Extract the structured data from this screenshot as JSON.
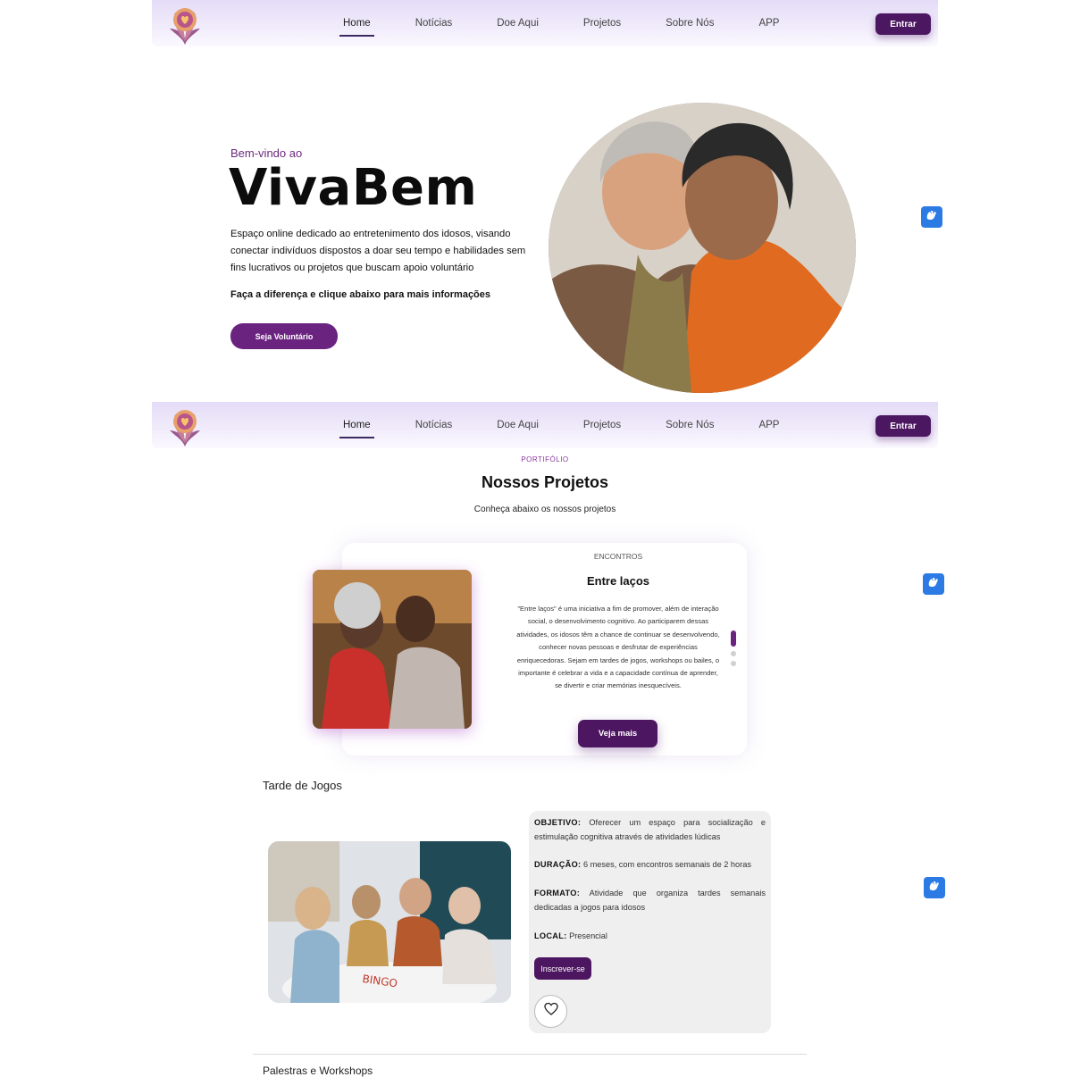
{
  "nav": {
    "links": [
      "Home",
      "Notícias",
      "Doe Aqui",
      "Projetos",
      "Sobre Nós",
      "APP"
    ],
    "enter_label": "Entrar"
  },
  "hero": {
    "welcome": "Bem-vindo ao",
    "title": "VivaBem",
    "description": "Espaço online dedicado ao entretenimento dos idosos, visando conectar indivíduos dispostos a doar seu tempo e habilidades sem fins lucrativos ou projetos que buscam apoio voluntário",
    "cta_text": "Faça a diferença e clique abaixo para mais informações",
    "button_label": "Seja Voluntário"
  },
  "projects": {
    "section_label": "PORTIFÓLIO",
    "title": "Nossos Projetos",
    "subtitle": "Conheça abaixo os nossos projetos",
    "card": {
      "category": "ENCONTROS",
      "title": "Entre laços",
      "description": "\"Entre laços\" é uma iniciativa a fim de promover, além de interação social, o desenvolvimento cognitivo. Ao participarem dessas atividades, os idosos têm a chance de continuar se desenvolvendo, conhecer novas pessoas e desfrutar de experiências enriquecedoras. Sejam em tardes de jogos, workshops ou bailes, o importante é celebrar a vida e a capacidade contínua de aprender, se divertir e criar memórias inesquecíveis.",
      "button_label": "Veja mais"
    },
    "project": {
      "name": "Tarde de Jogos",
      "objetivo_label": "OBJETIVO:",
      "objetivo": "Oferecer um espaço para socialização e estimulação cognitiva através de atividades lúdicas",
      "duracao_label": "DURAÇÃO:",
      "duracao": "6 meses, com encontros semanais de 2 horas",
      "formato_label": "FORMATO:",
      "formato": "Atividade que organiza tardes semanais dedicadas a jogos para idosos",
      "local_label": "LOCAL:",
      "local": "Presencial",
      "subscribe_label": "Inscrever-se",
      "photo_text": "BINGO"
    },
    "next_project_name": "Palestras e Workshops"
  },
  "icons": {
    "logo": "lotus-heart-logo",
    "accessibility": "sign-language-hands-icon",
    "favorite": "heart-icon"
  },
  "colors": {
    "brand_purple": "#4d1661",
    "accent_purple": "#6b2380",
    "accessibility_blue": "#2c7be5"
  }
}
